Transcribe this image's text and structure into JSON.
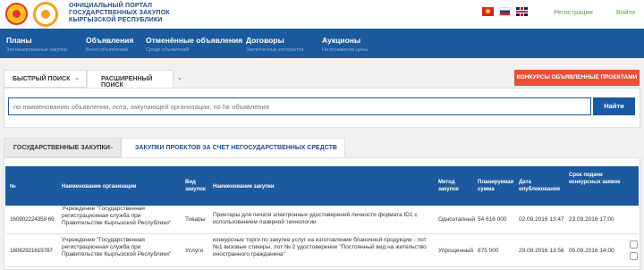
{
  "header": {
    "title_lines": [
      "ОФИЦИАЛЬНЫЙ ПОРТАЛ",
      "ГОСУДАРСТВЕННЫХ ЗАКУПОК",
      "КЫРГЫЗСКОЙ РЕСПУБЛИКИ"
    ],
    "register_label": "Регистрация",
    "login_label": "Войти"
  },
  "nav": [
    {
      "title": "Планы",
      "subtitle": "Запланированные закупки"
    },
    {
      "title": "Объявления",
      "subtitle": "Всего объявлений"
    },
    {
      "title": "Отменённые объявления",
      "subtitle": "Среди объявлений"
    },
    {
      "title": "Договоры",
      "subtitle": "Заключенных контрактов"
    },
    {
      "title": "Аукционы",
      "subtitle": "На понижение цены"
    }
  ],
  "search": {
    "quick_tab": "БЫСТРЫЙ ПОИСК",
    "advanced_tab": "РАСШИРЕННЫЙ ПОИСК",
    "contest_button": "КОНКУРСЫ ОБЪЯВЛЕННЫЕ ПРОЕКТАМИ",
    "placeholder": "по наименованию объявления, лота, закупающей организации, по № объявления",
    "find_button": "Найти"
  },
  "procurement_tabs": {
    "gov": "ГОСУДАРСТВЕННЫЕ ЗАКУПКИ",
    "nongov": "ЗАКУПКИ ПРОЕКТОВ ЗА СЧЕТ НЕГОСУДАРСТВЕННЫХ СРЕДСТВ"
  },
  "table": {
    "headers": [
      "№",
      "Наименование организации",
      "Вид закупок",
      "Наименование закупки",
      "Метод закупок",
      "Планируемая сумма",
      "Дата опубликования",
      "Срок подачи конкурсных заявок"
    ],
    "rows": [
      {
        "number": "160902224359 69",
        "org": "Учреждение \"Государственная регистрационная служба при Правительстве Кыргызской Республики\"",
        "type": "Товары",
        "name": "Принтеры для печати электронных удостоверений личности формата ID1 с использованием лазерной технологии",
        "method": "Одноэтапный",
        "sum": "54 616 000",
        "published": "02.09.2016 13:47",
        "deadline": "23.09.2016 17:00"
      },
      {
        "number": "16082921619787",
        "org": "Учреждение \"Государственная регистрационная служба при Правительстве Кыргызской Республики\"",
        "type": "Услуги",
        "name": "конкурсные торги по закупке услуг на изготовление бланочной продукции - лот №1 визовые стикеры, лот № 2 удостоверение \"Постоянный вид на жительство иностранного гражданина\"",
        "method": "Упрощенный",
        "sum": "875 000",
        "published": "29.08.2016 13:56",
        "deadline": "05.09.2016 14:00"
      }
    ]
  },
  "colors": {
    "brand_blue": "#1b5a9e",
    "accent_red": "#e8503a",
    "link_green": "#5aa44a"
  }
}
